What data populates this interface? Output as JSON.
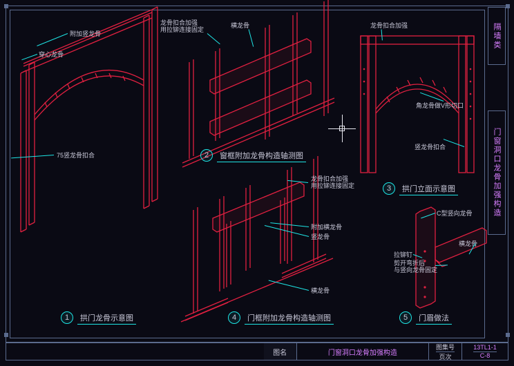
{
  "side_panel_top": "隔墙类",
  "side_panel_mid": "门窗洞口龙骨加强构造",
  "titleblock": {
    "label_name": "图名",
    "drawing_name": "门窗洞口龙骨加强构造",
    "label_set": "图集号",
    "set_no": "13TL1-1",
    "label_pg": "页次",
    "page_no": "C-8"
  },
  "figures": {
    "f1": {
      "num": "1",
      "title": "拱门龙骨示意图"
    },
    "f2": {
      "num": "2",
      "title": "窗框附加龙骨构造轴测图"
    },
    "f3": {
      "num": "3",
      "title": "拱门立面示意图"
    },
    "f4": {
      "num": "4",
      "title": "门框附加龙骨构造轴测图"
    },
    "f5": {
      "num": "5",
      "title": "门眉做法"
    }
  },
  "ann": {
    "a1_1": "附加竖龙骨",
    "a1_2": "穿心龙骨",
    "a1_3": "75竖龙骨扣合",
    "a2_1": "龙骨扣合加强\n用拉铆连接固定",
    "a2_2": "横龙骨",
    "a3_1": "龙骨扣合加强",
    "a3_2": "角龙骨做V形切口",
    "a3_3": "竖龙骨扣合",
    "a4_1": "龙骨扣合加强\n用拉铆连接固定",
    "a4_2": "附加横龙骨",
    "a4_3": "竖龙骨",
    "a4_4": "横龙骨",
    "a5_1": "C型竖向龙骨",
    "a5_2": "横龙骨",
    "a5_3": "拉铆钉",
    "a5_4": "剪开弯折后\n与竖向龙骨固定"
  }
}
